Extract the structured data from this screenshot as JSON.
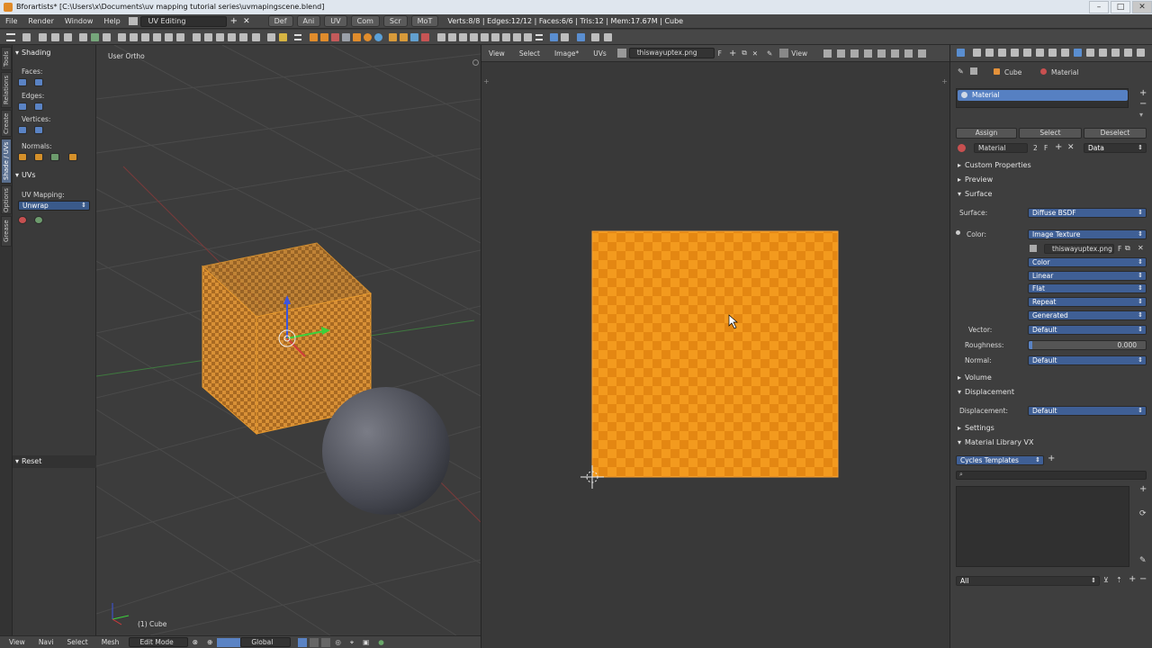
{
  "window": {
    "title": "Bforartists* [C:\\Users\\x\\Documents\\uv mapping tutorial series\\uvmapingscene.blend]"
  },
  "infobar": {
    "menus": [
      "File",
      "Render",
      "Window",
      "Help"
    ],
    "layout": "UV Editing",
    "tabs": [
      "Def",
      "Ani",
      "UV",
      "Com",
      "Scr",
      "MoT"
    ],
    "stats": "Verts:8/8 | Edges:12/12 | Faces:6/6 | Tris:12 | Mem:17.67M | Cube"
  },
  "left_tabs": [
    "Tools",
    "Relations",
    "Create",
    "Shade / UVs",
    "Options",
    "Grease Pencil"
  ],
  "tool_panel": {
    "shading_header": "Shading",
    "faces_label": "Faces:",
    "edges_label": "Edges:",
    "vertices_label": "Vertices:",
    "normals_label": "Normals:",
    "uvs_header": "UVs",
    "uv_mapping_label": "UV Mapping:",
    "uv_mapping_value": "Unwrap",
    "reset_header": "Reset"
  },
  "viewport": {
    "view_label": "User Ortho",
    "object_label": "(1) Cube"
  },
  "bottom_bar": {
    "menus": [
      "View",
      "Navi",
      "Select",
      "Mesh"
    ],
    "mode": "Edit Mode",
    "orientation": "Global"
  },
  "uv_editor": {
    "menus": [
      "View",
      "Select",
      "Image*",
      "UVs"
    ],
    "image_name": "thiswayuptex.png",
    "fake_user": "F",
    "view_dropdown": "View",
    "texture_color_a": "#f39a1e",
    "texture_color_b": "#e48712"
  },
  "properties": {
    "breadcrumb_object": "Cube",
    "breadcrumb_material": "Material",
    "slot_name": "Material",
    "assign": "Assign",
    "select": "Select",
    "deselect": "Deselect",
    "material_name": "Material",
    "user_count": "2",
    "fake_user": "F",
    "link": "Data",
    "sections": {
      "custom_properties": "Custom Properties",
      "preview": "Preview",
      "surface": "Surface",
      "volume": "Volume",
      "displacement": "Displacement",
      "settings": "Settings",
      "material_library": "Material Library VX"
    },
    "surface_label": "Surface:",
    "surface_value": "Diffuse BSDF",
    "color_label": "Color:",
    "color_value": "Image Texture",
    "image_name": "thiswayuptex.png",
    "image_fake_user": "F",
    "color_space": "Color",
    "interpolation": "Linear",
    "projection": "Flat",
    "extension": "Repeat",
    "source": "Generated",
    "vector_label": "Vector:",
    "vector_value": "Default",
    "roughness_label": "Roughness:",
    "roughness_value": "0.000",
    "normal_label": "Normal:",
    "normal_value": "Default",
    "displacement_label": "Displacement:",
    "displacement_value": "Default",
    "library": "Cycles Templates",
    "filter": "All"
  }
}
